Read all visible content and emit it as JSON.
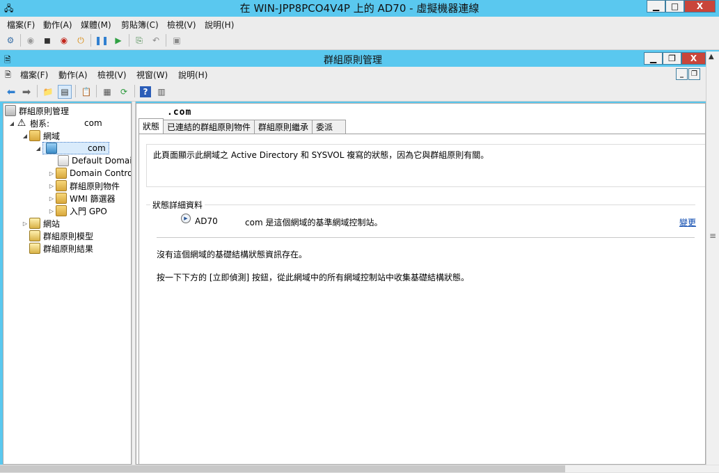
{
  "outer_window": {
    "title": "在 WIN-JPP8PCO4V4P 上的 AD70 - 虛擬機器連線",
    "buttons": {
      "minimize": "▁",
      "maximize": "□",
      "close": "X"
    },
    "menu": [
      "檔案(F)",
      "動作(A)",
      "媒體(M)",
      "剪貼簿(C)",
      "檢視(V)",
      "說明(H)"
    ]
  },
  "inner_window": {
    "title": "群組原則管理",
    "buttons": {
      "minimize": "▁",
      "restore": "❐",
      "close": "X"
    },
    "menu": [
      "檔案(F)",
      "動作(A)",
      "檢視(V)",
      "視窗(W)",
      "說明(H)"
    ],
    "mdi_buttons": {
      "minimize": "_",
      "restore": "❐"
    }
  },
  "tree": {
    "root": "群組原則管理",
    "forest": "樹系:",
    "forest_suffix": "com",
    "domains": "網域",
    "domain_suffix": "com",
    "default_policy": "Default Domai",
    "domain_controllers": "Domain Contro",
    "gpo_objects": "群組原則物件",
    "wmi_filters": "WMI 篩選器",
    "starter_gpo": "入門 GPO",
    "sites": "網站",
    "modeling": "群組原則模型",
    "results": "群組原則結果"
  },
  "details": {
    "domain_header": ".com",
    "tabs": [
      "狀態",
      "已連結的群組原則物件",
      "群組原則繼承",
      "委派"
    ],
    "active_tab": "狀態",
    "description": "此頁面顯示此網域之 Active Directory 和 SYSVOL 複寫的狀態，因為它與群組原則有關。",
    "status_legend": "狀態詳細資料",
    "pdc_name": "AD70",
    "pdc_text": "com 是這個網域的基準網域控制站。",
    "change_link": "變更",
    "info_line_1": "沒有這個網域的基礎結構狀態資訊存在。",
    "info_line_2": "按一下下方的 [立即偵測] 按鈕，從此網域中的所有網域控制站中收集基礎結構狀態。"
  },
  "colors": {
    "title_bar": "#5ac8ef",
    "close_button": "#c9453a",
    "link": "#0645ad"
  }
}
